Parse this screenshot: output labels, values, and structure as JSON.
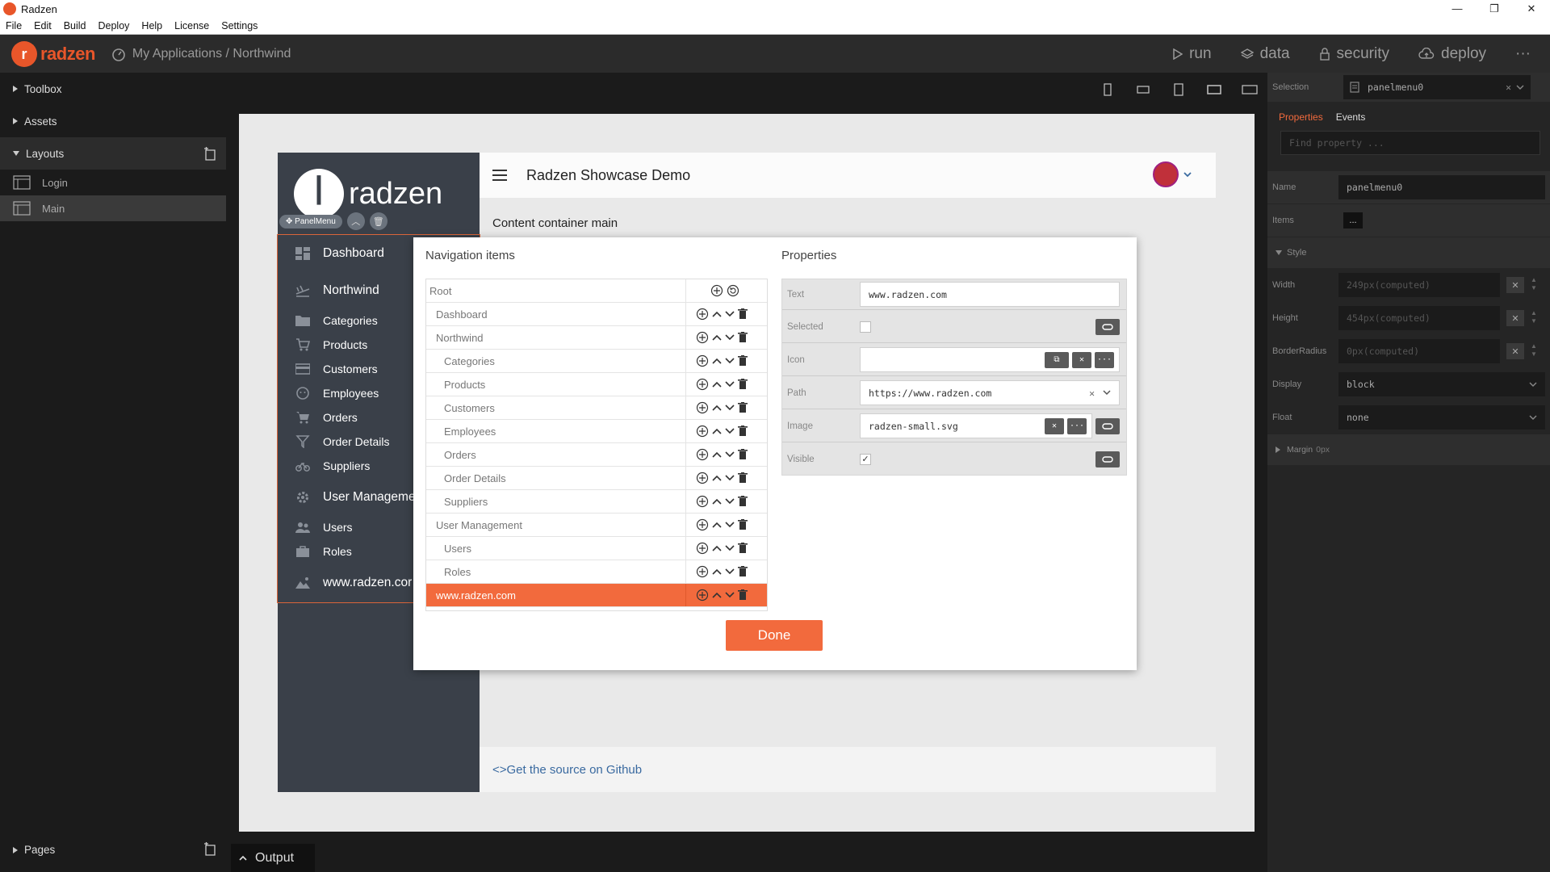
{
  "window": {
    "title": "Radzen",
    "controls": [
      "—",
      "❐",
      "✕"
    ]
  },
  "menu": [
    "File",
    "Edit",
    "Build",
    "Deploy",
    "Help",
    "License",
    "Settings"
  ],
  "header": {
    "brand": "radzen",
    "brand_initial": "r",
    "breadcrumb": "My Applications / Northwind",
    "nav": {
      "run": "run",
      "data": "data",
      "security": "security",
      "deploy": "deploy",
      "more": "···"
    }
  },
  "left": {
    "toolbox": "Toolbox",
    "assets": "Assets",
    "layouts": "Layouts",
    "layout_items": [
      "Login",
      "Main"
    ],
    "pages": "Pages"
  },
  "output": {
    "label": "Output"
  },
  "demo": {
    "logo_text": "radzen",
    "component_tag": "PanelMenu",
    "header_title": "Radzen Showcase Demo",
    "content_label": "Content container main",
    "footer_link": "<>Get the source on Github",
    "menu": {
      "dashboard": "Dashboard",
      "northwind": "Northwind",
      "categories": "Categories",
      "products": "Products",
      "customers": "Customers",
      "employees": "Employees",
      "orders": "Orders",
      "order_details": "Order Details",
      "suppliers": "Suppliers",
      "user_management": "User Manageme",
      "users": "Users",
      "roles": "Roles",
      "radzen": "www.radzen.cor"
    }
  },
  "modal": {
    "nav_title": "Navigation items",
    "props_title": "Properties",
    "tree": [
      {
        "label": "Root",
        "level": 0
      },
      {
        "label": "Dashboard",
        "level": 1
      },
      {
        "label": "Northwind",
        "level": 1
      },
      {
        "label": "Categories",
        "level": 2
      },
      {
        "label": "Products",
        "level": 2
      },
      {
        "label": "Customers",
        "level": 2
      },
      {
        "label": "Employees",
        "level": 2
      },
      {
        "label": "Orders",
        "level": 2
      },
      {
        "label": "Order Details",
        "level": 2
      },
      {
        "label": "Suppliers",
        "level": 2
      },
      {
        "label": "User Management",
        "level": 1
      },
      {
        "label": "Users",
        "level": 2
      },
      {
        "label": "Roles",
        "level": 2
      },
      {
        "label": "www.radzen.com",
        "level": 1,
        "selected": true
      }
    ],
    "props": {
      "text_label": "Text",
      "text_value": "www.radzen.com",
      "selected_label": "Selected",
      "icon_label": "Icon",
      "path_label": "Path",
      "path_value": "https://www.radzen.com",
      "image_label": "Image",
      "image_value": "radzen-small.svg",
      "visible_label": "Visible"
    },
    "done": "Done"
  },
  "right": {
    "selection_label": "Selection",
    "selection_value": "panelmenu0",
    "tabs": [
      "Properties",
      "Events"
    ],
    "find_placeholder": "Find property ...",
    "name_label": "Name",
    "name_value": "panelmenu0",
    "items_label": "Items",
    "items_btn": "...",
    "style_label": "Style",
    "width_label": "Width",
    "width_value": "249px(computed)",
    "height_label": "Height",
    "height_value": "454px(computed)",
    "radius_label": "BorderRadius",
    "radius_value": "0px(computed)",
    "display_label": "Display",
    "display_value": "block",
    "float_label": "Float",
    "float_value": "none",
    "margin_label": "Margin",
    "margin_value": "0px"
  },
  "colors": {
    "accent": "#f26a3d",
    "brand": "#e8562a",
    "demo_sidebar": "#3a4049"
  }
}
